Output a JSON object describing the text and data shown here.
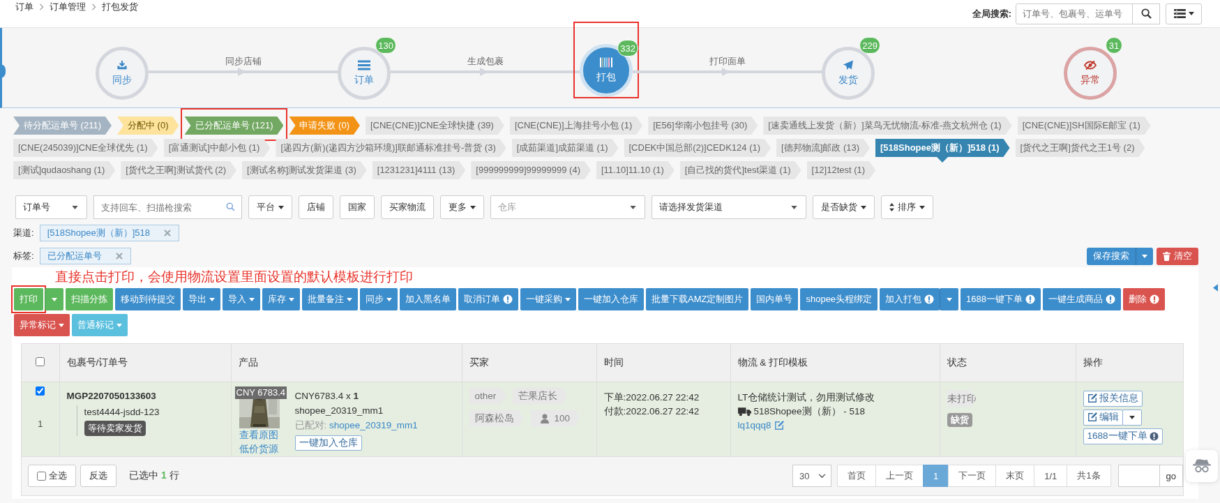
{
  "breadcrumb": [
    "订单",
    "订单管理",
    "打包发货"
  ],
  "global_search": {
    "label": "全局搜索:",
    "placeholder": "订单号、包裹号、运单号"
  },
  "steps": [
    {
      "label": "同步",
      "kind": "sync",
      "selected": false,
      "highlighted": false,
      "next_label": "同步店铺"
    },
    {
      "label": "订单",
      "count": "130",
      "kind": "orders",
      "selected": false,
      "highlighted": false,
      "next_label": "生成包裹"
    },
    {
      "label": "打包",
      "count": "332",
      "kind": "pack",
      "selected": true,
      "highlighted": true,
      "next_label": "打印面单"
    },
    {
      "label": "发货",
      "count": "229",
      "kind": "ship",
      "selected": false,
      "highlighted": false
    },
    {
      "label": "异常",
      "count": "31",
      "kind": "error",
      "selected": false,
      "highlighted": false
    }
  ],
  "tag_rows": [
    [
      {
        "label": "待分配运单号 (211)",
        "kind": "status",
        "color": "#a5b4c2",
        "selected": false,
        "highlighted": false
      },
      {
        "label": "分配中 (0)",
        "kind": "status",
        "color": "#fde39c",
        "selected": false,
        "highlighted": false
      },
      {
        "label": "已分配运单号 (121)",
        "kind": "status",
        "color": "#72a862",
        "selected": false,
        "highlighted": true
      },
      {
        "label": "申请失败 (0)",
        "kind": "status",
        "color": "#f39316",
        "selected": false,
        "highlighted": false
      },
      {
        "label": "[CNE(CNE)]CNE全球快捷 (39)",
        "kind": "channel",
        "selected": false,
        "highlighted": false
      },
      {
        "label": "[CNE(CNE)]上海挂号小包 (1)",
        "kind": "channel",
        "selected": false,
        "highlighted": false
      },
      {
        "label": "[E56]华南小包挂号 (30)",
        "kind": "channel",
        "selected": false,
        "highlighted": false
      },
      {
        "label": "[速卖通线上发货（新）]菜鸟无忧物流-标准-燕文杭州仓 (1)",
        "kind": "channel",
        "selected": false,
        "highlighted": false
      },
      {
        "label": "[CNE(CNE)]SH国际E邮宝 (1)",
        "kind": "channel",
        "selected": false,
        "highlighted": false
      }
    ],
    [
      {
        "label": "[CNE(245039)]CNE全球优先 (1)",
        "kind": "channel",
        "selected": false,
        "highlighted": false
      },
      {
        "label": "[富通测试]中邮小包 (1)",
        "kind": "channel",
        "selected": false,
        "highlighted": false
      },
      {
        "label": "[递四方(新)(递四方沙箱环境)]联邮通标准挂号-普货 (3)",
        "kind": "channel",
        "selected": false,
        "highlighted": false
      },
      {
        "label": "[成茹渠道]成茹渠道 (1)",
        "kind": "channel",
        "selected": false,
        "highlighted": false
      },
      {
        "label": "[CDEK中国总部(2)]CEDK124 (1)",
        "kind": "channel",
        "selected": false,
        "highlighted": false
      },
      {
        "label": "[德邦物流]邮政 (13)",
        "kind": "channel",
        "selected": false,
        "highlighted": false
      },
      {
        "label": "[518Shopee测（新）]518 (1)",
        "kind": "channel",
        "selected": true,
        "highlighted": false
      },
      {
        "label": "[货代之王啊]货代之王1号 (2)",
        "kind": "channel",
        "selected": false,
        "highlighted": false
      }
    ],
    [
      {
        "label": "[测试]qudaoshang (1)",
        "kind": "channel",
        "selected": false,
        "highlighted": false
      },
      {
        "label": "[货代之王啊]测试货代 (2)",
        "kind": "channel",
        "selected": false,
        "highlighted": false
      },
      {
        "label": "[测试名称]测试发货渠道 (3)",
        "kind": "channel",
        "selected": false,
        "highlighted": false
      },
      {
        "label": "[1231231]4111 (13)",
        "kind": "channel",
        "selected": false,
        "highlighted": false
      },
      {
        "label": "[999999999]99999999 (4)",
        "kind": "channel",
        "selected": false,
        "highlighted": false
      },
      {
        "label": "[11.10]11.10 (1)",
        "kind": "channel",
        "selected": false,
        "highlighted": false
      },
      {
        "label": "[自己找的货代]test渠道 (1)",
        "kind": "channel",
        "selected": false,
        "highlighted": false
      },
      {
        "label": "[12]12test (1)",
        "kind": "channel",
        "selected": false,
        "highlighted": false
      }
    ]
  ],
  "filters": [
    {
      "kind": "select",
      "value": "订单号"
    },
    {
      "kind": "search",
      "placeholder": "支持回车、扫描枪搜索"
    },
    {
      "kind": "dropdown",
      "label": "平台"
    },
    {
      "kind": "button",
      "label": "店铺"
    },
    {
      "kind": "button",
      "label": "国家"
    },
    {
      "kind": "button",
      "label": "买家物流"
    },
    {
      "kind": "dropdown",
      "label": "更多"
    },
    {
      "kind": "select",
      "placeholder": "仓库"
    },
    {
      "kind": "select",
      "value": "请选择发货渠道"
    },
    {
      "kind": "dropdown",
      "label": "是否缺货"
    },
    {
      "kind": "sort",
      "label": "排序"
    }
  ],
  "active_filters": [
    {
      "label": "渠道:",
      "value": "[518Shopee测（新）]518"
    },
    {
      "label": "标签:",
      "value": "已分配运单号"
    }
  ],
  "search_actions": [
    {
      "label": "保存搜索",
      "kind": "split"
    },
    {
      "label": "清空",
      "kind": "danger"
    }
  ],
  "annotation": "直接点击打印，会使用物流设置里面设置的默认模板进行打印",
  "action_rows": [
    [
      {
        "label": "打印",
        "kind": "success",
        "split": true,
        "highlighted": true
      },
      {
        "label": "扫描分拣",
        "kind": "success",
        "highlighted": false
      },
      {
        "label": "移动到待提交",
        "kind": "primary",
        "highlighted": false
      },
      {
        "label": "导出",
        "kind": "primary",
        "caret": true,
        "highlighted": false
      },
      {
        "label": "导入",
        "kind": "primary",
        "caret": true,
        "highlighted": false
      },
      {
        "label": "库存",
        "kind": "primary",
        "caret": true,
        "highlighted": false
      },
      {
        "label": "批量备注",
        "kind": "primary",
        "caret": true,
        "highlighted": false
      },
      {
        "label": "同步",
        "kind": "primary",
        "caret": true,
        "highlighted": false
      },
      {
        "label": "加入黑名单",
        "kind": "primary",
        "highlighted": false
      },
      {
        "label": "取消订单",
        "kind": "primary",
        "info": true,
        "highlighted": false
      },
      {
        "label": "一键采购",
        "kind": "primary",
        "caret": true,
        "highlighted": false
      },
      {
        "label": "一键加入仓库",
        "kind": "primary",
        "highlighted": false
      },
      {
        "label": "批量下载AMZ定制图片",
        "kind": "primary",
        "highlighted": false
      },
      {
        "label": "国内单号",
        "kind": "primary",
        "highlighted": false
      },
      {
        "label": "shopee头程绑定",
        "kind": "primary",
        "highlighted": false
      },
      {
        "label": "加入打包",
        "kind": "primary",
        "info": true,
        "split": true,
        "highlighted": false
      },
      {
        "label": "1688一键下单",
        "kind": "primary",
        "info": true,
        "highlighted": false
      },
      {
        "label": "一键生成商品",
        "kind": "primary",
        "info": true,
        "highlighted": false
      },
      {
        "label": "删除",
        "kind": "danger",
        "info": true,
        "highlighted": false
      }
    ],
    [
      {
        "label": "异常标记",
        "kind": "danger",
        "caret": true,
        "highlighted": false
      },
      {
        "label": "普通标记",
        "kind": "info",
        "caret": true,
        "highlighted": false
      }
    ]
  ],
  "table": {
    "select_all_checked": false,
    "columns": [
      "包裹号/订单号",
      "产品",
      "买家",
      "时间",
      "物流 & 打印模板",
      "状态",
      "操作"
    ],
    "rows": [
      {
        "selected": true,
        "checked": true,
        "index": "1",
        "package_no": "MGP2207050133603",
        "order_no": "test4444-jsdd-123",
        "order_status": "等待卖家发货",
        "product": {
          "price_overlay": "CNY 6783.4",
          "price_line": "CNY6783.4 x **1**",
          "sku": "shopee_20319_mm1",
          "paired_label": "已配对: ",
          "paired_sku": "shopee_20319_mm1",
          "links": [
            "查看原图",
            "低价货源"
          ],
          "button": "一键加入仓库"
        },
        "buyer": {
          "tags": [
            "other",
            "芒果店长",
            "阿森松岛"
          ],
          "score": "100"
        },
        "times": [
          "下单:2022.06.27 22:42",
          "付款:2022.06.27 22:42"
        ],
        "logistics": {
          "name": "LT仓储统计测试，勿用测试修改",
          "channel": "518Shopee测（新） - 518",
          "tracking": "lq1qqq8"
        },
        "statuses": [
          {
            "label": "未打印",
            "kind": "tag"
          },
          {
            "label": "缺货",
            "kind": "badge"
          }
        ],
        "actions": [
          {
            "label": "报关信息",
            "kind": "edit"
          },
          {
            "label": "编辑",
            "kind": "edit_split"
          },
          {
            "label": "1688一键下单",
            "kind": "info"
          }
        ]
      }
    ]
  },
  "footer": {
    "select_all": {
      "label": "全选",
      "checked": false
    },
    "invert": "反选",
    "selection_text": "已选中 **1** 行",
    "page_size": "30",
    "pages": [
      {
        "label": "首页",
        "selected": false
      },
      {
        "label": "上一页",
        "selected": false
      },
      {
        "label": "1",
        "selected": true
      },
      {
        "label": "下一页",
        "selected": false
      },
      {
        "label": "末页",
        "selected": false
      },
      {
        "label": "1/1",
        "selected": false
      },
      {
        "label": "共1条",
        "selected": false
      }
    ],
    "go": "go"
  }
}
